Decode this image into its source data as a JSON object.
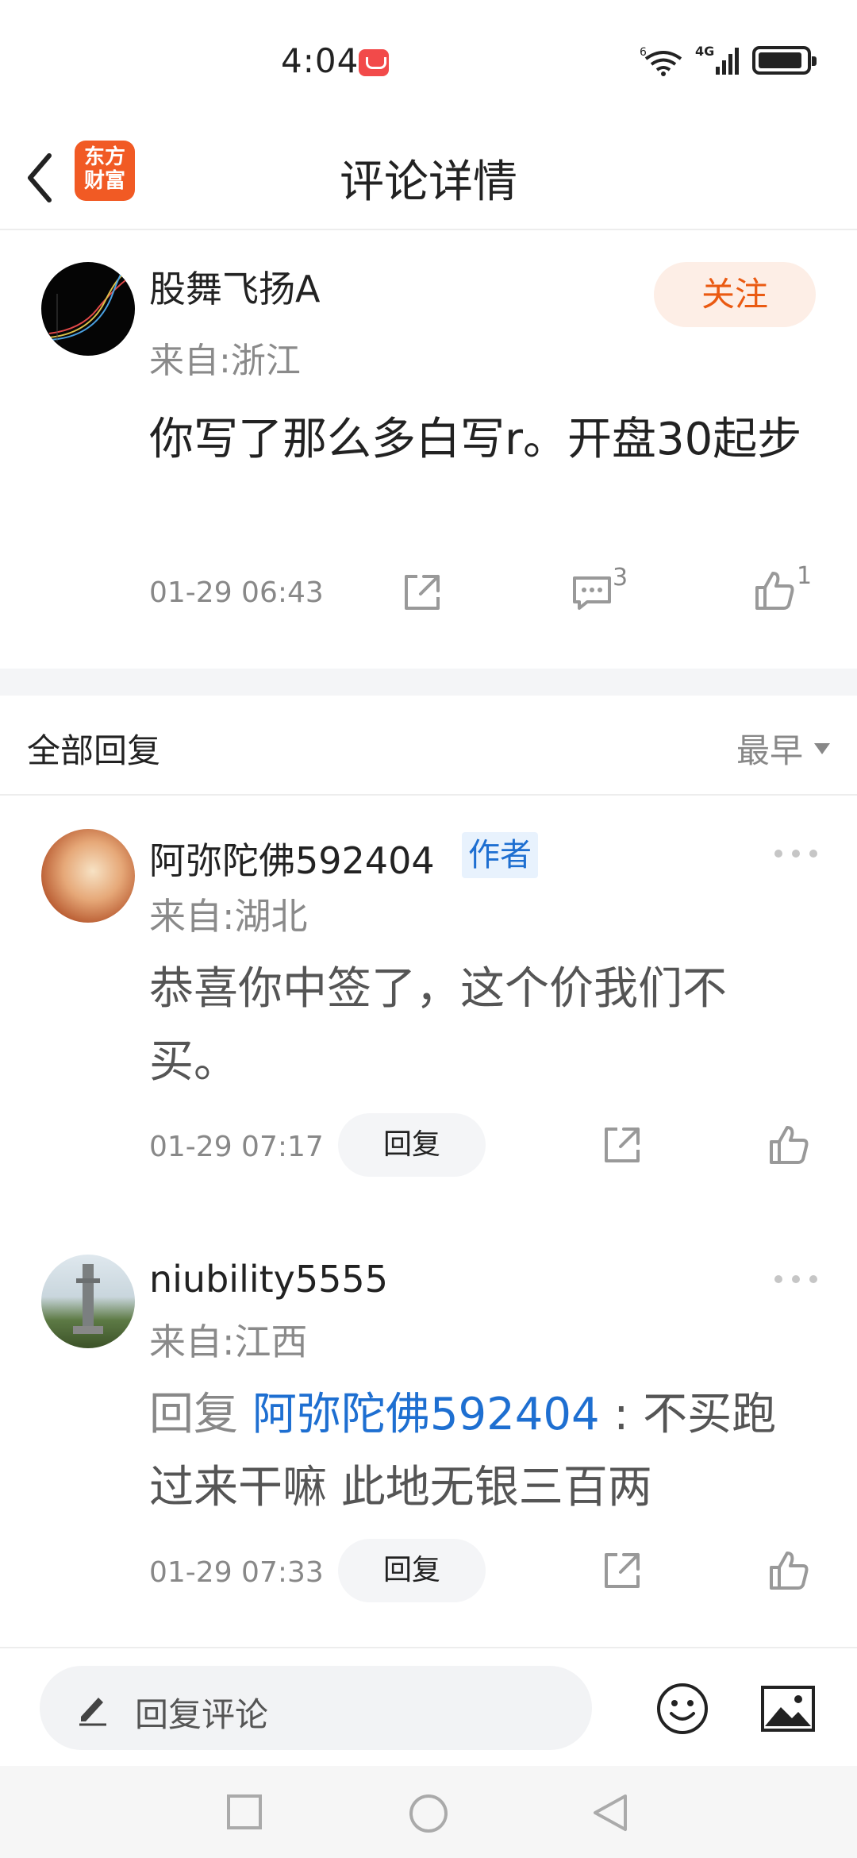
{
  "status_bar": {
    "time": "4:04",
    "network_label": "4G",
    "wifi_label": "6"
  },
  "header": {
    "title": "评论详情",
    "logo_line1": "东方",
    "logo_line2": "财富"
  },
  "main_comment": {
    "username": "股舞飞扬A",
    "location": "来自:浙江",
    "follow_label": "关注",
    "text": "你写了那么多白写r。开盘30起步",
    "time": "01-29 06:43",
    "comment_count": "3",
    "like_count": "1"
  },
  "replies_section": {
    "title": "全部回复",
    "sort_label": "最早"
  },
  "replies": [
    {
      "username": "阿弥陀佛592404",
      "badge": "作者",
      "location": "来自:湖北",
      "text": "恭喜你中签了，这个价我们不买。",
      "time": "01-29 07:17",
      "reply_label": "回复"
    },
    {
      "username": "niubility5555",
      "location": "来自:江西",
      "reply_prefix": "回复 ",
      "mention": "阿弥陀佛592404",
      "text": " : 不买跑过来干嘛 此地无银三百两",
      "time": "01-29 07:33",
      "reply_label": "回复"
    }
  ],
  "bottom_bar": {
    "placeholder": "回复评论"
  },
  "colors": {
    "accent": "#ea5a12",
    "link": "#1e6fd1",
    "brand": "#f15a24"
  }
}
